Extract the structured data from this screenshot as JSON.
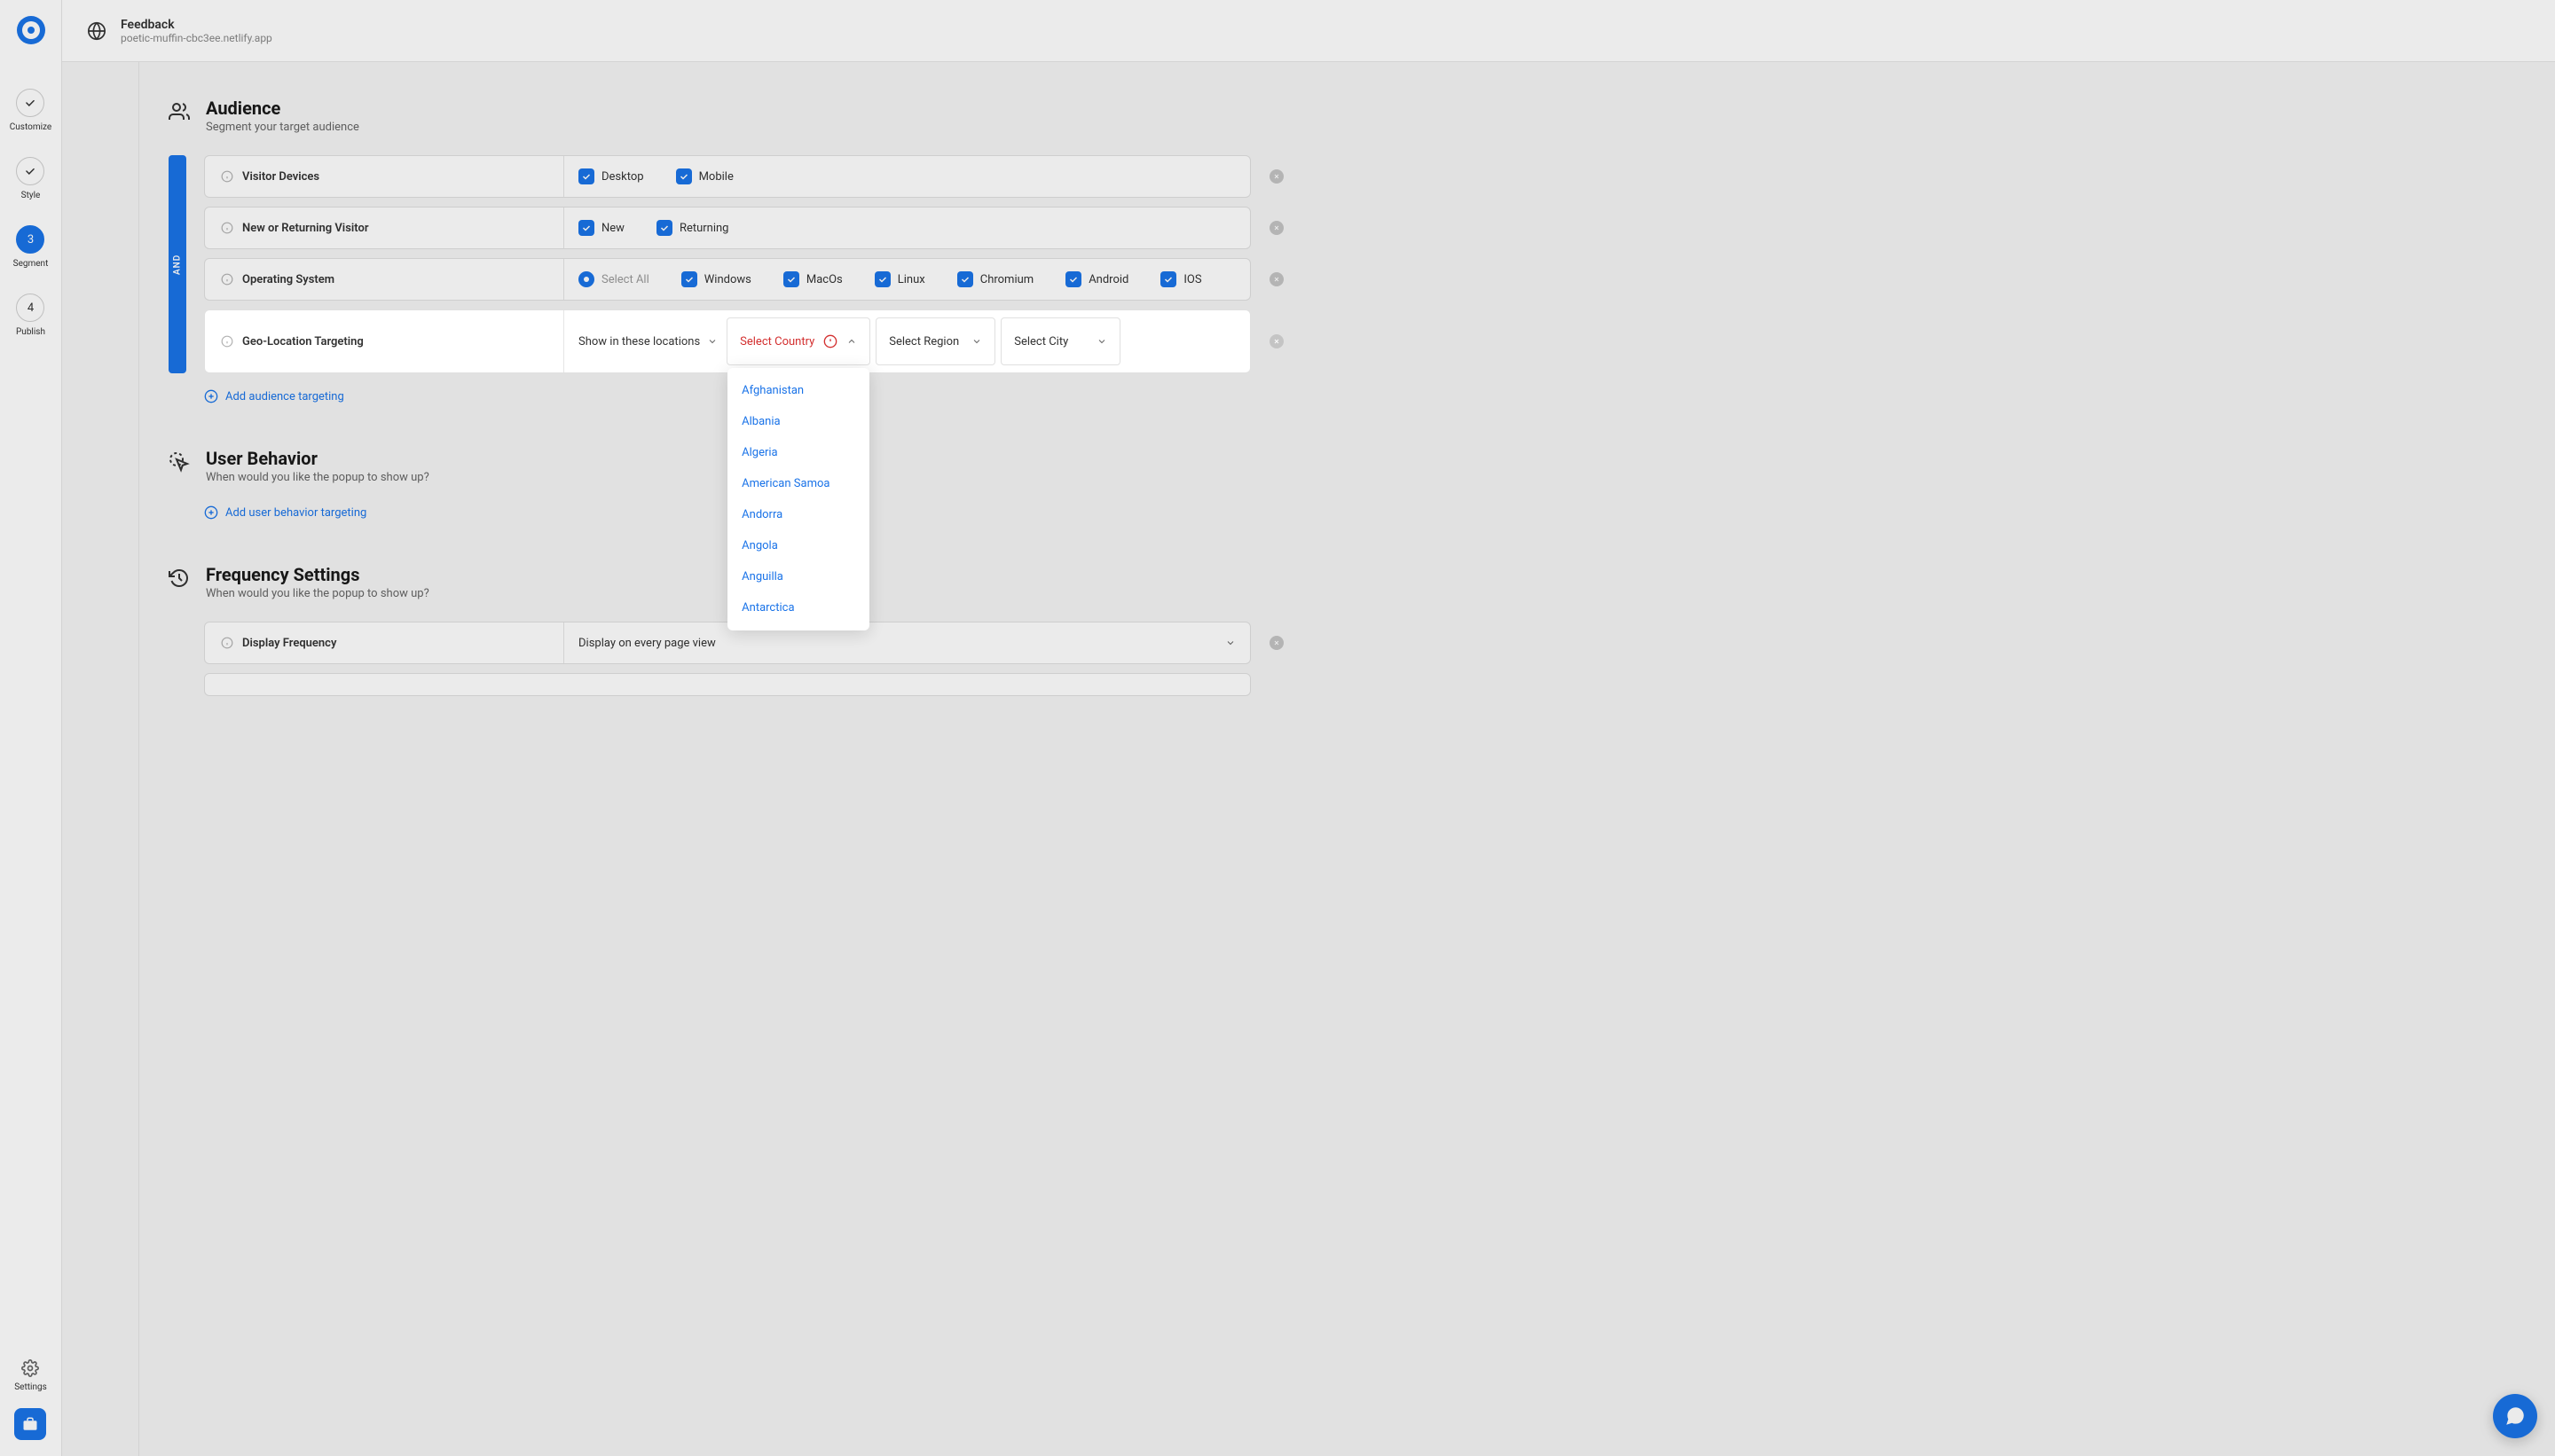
{
  "header": {
    "title": "Feedback",
    "subtitle": "poetic-muffin-cbc3ee.netlify.app"
  },
  "nav": {
    "customize": "Customize",
    "style": "Style",
    "segment_num": "3",
    "segment": "Segment",
    "publish_num": "4",
    "publish": "Publish",
    "settings": "Settings"
  },
  "audience": {
    "title": "Audience",
    "subtitle": "Segment your target audience",
    "and": "AND",
    "rows": {
      "devices": {
        "label": "Visitor Devices",
        "desktop": "Desktop",
        "mobile": "Mobile"
      },
      "visitor": {
        "label": "New or Returning Visitor",
        "new": "New",
        "returning": "Returning"
      },
      "os": {
        "label": "Operating System",
        "select_all": "Select All",
        "windows": "Windows",
        "macos": "MacOs",
        "linux": "Linux",
        "chromium": "Chromium",
        "android": "Android",
        "ios": "IOS"
      },
      "geo": {
        "label": "Geo-Location Targeting",
        "show_in": "Show in these locations",
        "select_country": "Select Country",
        "select_region": "Select Region",
        "select_city": "Select City"
      }
    },
    "add_link": "Add audience targeting"
  },
  "behavior": {
    "title": "User Behavior",
    "subtitle": "When would you like the popup to show up?",
    "add_link": "Add user behavior targeting"
  },
  "frequency": {
    "title": "Frequency Settings",
    "subtitle": "When would you like the popup to show up?",
    "display_label": "Display Frequency",
    "display_value": "Display on every page view"
  },
  "countries": [
    "Afghanistan",
    "Albania",
    "Algeria",
    "American Samoa",
    "Andorra",
    "Angola",
    "Anguilla",
    "Antarctica"
  ]
}
